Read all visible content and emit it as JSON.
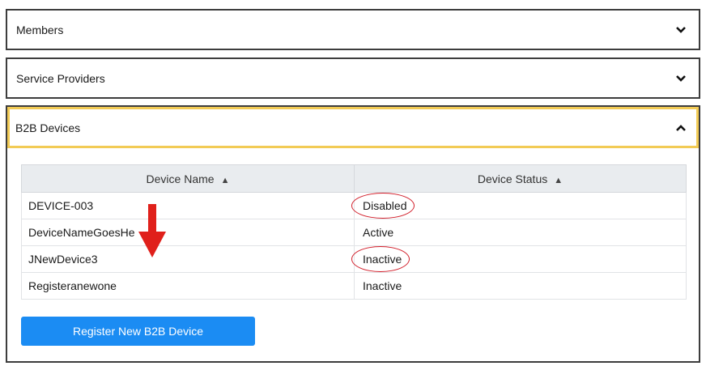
{
  "accordion": {
    "members_label": "Members",
    "providers_label": "Service Providers",
    "b2b_label": "B2B Devices"
  },
  "table": {
    "headers": [
      "Device Name",
      "Device Status"
    ],
    "rows": [
      {
        "name": "DEVICE-003",
        "status": "Disabled"
      },
      {
        "name": "DeviceNameGoesHe",
        "status": "Active"
      },
      {
        "name": "JNewDevice3",
        "status": "Inactive"
      },
      {
        "name": "Registeranewone",
        "status": "Inactive"
      }
    ]
  },
  "register_button_label": "Register New B2B Device",
  "colors": {
    "accent_border": "#f2cb55",
    "button": "#1b8cf3",
    "annotation": "#d21f2b"
  },
  "icons": {
    "collapsed": "chevron-down-icon",
    "expanded": "chevron-up-icon",
    "sort": "sort-icon"
  }
}
